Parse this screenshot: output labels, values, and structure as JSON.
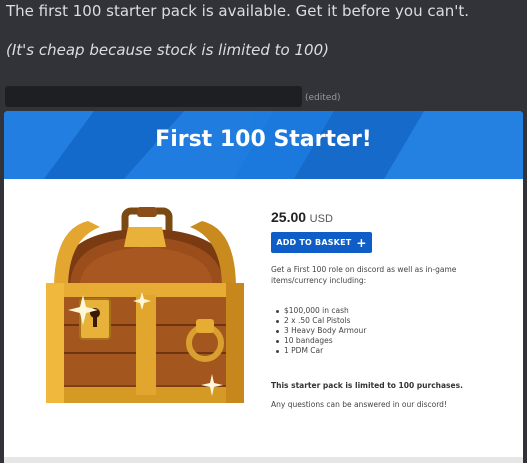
{
  "message": {
    "line1": "The first 100 starter pack is available. Get it before you can't.",
    "line2": "(It's cheap because stock is limited to 100)",
    "edited": "(edited)"
  },
  "embed": {
    "title": "First 100 Starter!",
    "price_amount": "25.00",
    "price_currency": "USD",
    "add_button": "ADD TO BASKET",
    "add_button_icon": "plus-icon",
    "description": "Get a First 100 role on discord as well as in-game items/currency including:",
    "items": [
      "$100,000 in cash",
      "2 x .50 Cal Pistols",
      "3 Heavy Body Armour",
      "10 bandages",
      "1 PDM Car"
    ],
    "limit_note": "This starter pack is limited to 100 purchases.",
    "questions_note": "Any questions can be answered in our discord!",
    "image_icon": "treasure-chest-icon"
  },
  "colors": {
    "background": "#313338",
    "banner": "#1a73d4",
    "button": "#0f5ec7",
    "text": "#dbdee1"
  }
}
